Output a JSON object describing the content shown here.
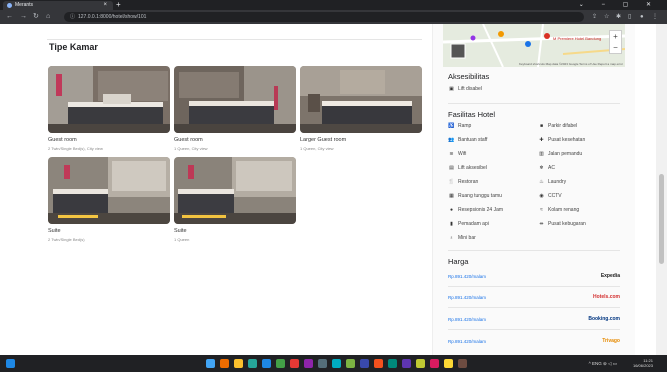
{
  "browser": {
    "tab_title": "Merants",
    "tab_close": "×",
    "new_tab": "+",
    "url": "127.0.0.1:8000/hotel/show/101",
    "win_controls": "⌄ − ▢ ✕"
  },
  "rooms": {
    "section_title": "Tipe Kamar",
    "items": [
      {
        "name": "Guest room",
        "detail": "2 Twin/Single Bed(s), City view"
      },
      {
        "name": "Guest room",
        "detail": "1 Queen, City view"
      },
      {
        "name": "Larger Guest room",
        "detail": "1 Queen, City view"
      },
      {
        "name": "Suite",
        "detail": "2 Twin/Single Bed(s)"
      },
      {
        "name": "Suite",
        "detail": "1 Queen"
      }
    ]
  },
  "map": {
    "place_label": "M Premiere Hotel Bandung",
    "zoom_in": "+",
    "zoom_out": "−",
    "attribution": "Keyboard shortcuts  Map data ©2023 Google  Terms of Use  Report a map error"
  },
  "accessibility": {
    "title": "Aksesibilitas",
    "items": [
      {
        "icon": "elevator-icon",
        "glyph": "▣",
        "label": "Lift disabel"
      }
    ]
  },
  "facilities": {
    "title": "Fasilitas Hotel",
    "left": [
      {
        "icon": "ramp-icon",
        "glyph": "♿",
        "label": "Ramp"
      },
      {
        "icon": "staff-icon",
        "glyph": "👥",
        "label": "Bantuan staff"
      },
      {
        "icon": "wifi-icon",
        "glyph": "≋",
        "label": "Wifi"
      },
      {
        "icon": "elevator-icon",
        "glyph": "▤",
        "label": "Lift aksesibel"
      },
      {
        "icon": "restaurant-icon",
        "glyph": "🍴",
        "label": "Restoran"
      },
      {
        "icon": "lounge-icon",
        "glyph": "▦",
        "label": "Ruang tunggu tamu"
      },
      {
        "icon": "reception-icon",
        "glyph": "●",
        "label": "Resepsionis 24 Jam"
      },
      {
        "icon": "fire-extinguisher-icon",
        "glyph": "▮",
        "label": "Pemadam api"
      },
      {
        "icon": "minibar-icon",
        "glyph": "♁",
        "label": "Mini bar"
      }
    ],
    "right": [
      {
        "icon": "parking-icon",
        "glyph": "■",
        "label": "Parkir difabel"
      },
      {
        "icon": "health-icon",
        "glyph": "✚",
        "label": "Pusat kesehatan"
      },
      {
        "icon": "walkway-icon",
        "glyph": "▥",
        "label": "Jalan pemandu"
      },
      {
        "icon": "ac-icon",
        "glyph": "❄",
        "label": "AC"
      },
      {
        "icon": "laundry-icon",
        "glyph": "♨",
        "label": "Laundry"
      },
      {
        "icon": "cctv-icon",
        "glyph": "◉",
        "label": "CCTV"
      },
      {
        "icon": "pool-icon",
        "glyph": "≈",
        "label": "Kolam renang"
      },
      {
        "icon": "gym-icon",
        "glyph": "⇹",
        "label": "Pusat kebugaran"
      }
    ]
  },
  "prices": {
    "title": "Harga",
    "items": [
      {
        "price": "Rp.891.420/malam",
        "provider": "Expedia",
        "color": "#1a1a1a"
      },
      {
        "price": "Rp.891.420/malam",
        "provider": "Hotels.com",
        "color": "#d32f2f"
      },
      {
        "price": "Rp.891.420/malam",
        "provider": "Booking.com",
        "color": "#003580"
      },
      {
        "price": "Rp.891.420/malam",
        "provider": "Trivago",
        "color": "#e68a00"
      }
    ]
  },
  "taskbar": {
    "tray_text": "^  ENG  ⊜ ◁ ▭",
    "time": "11:21",
    "date": "16/06/2023"
  }
}
